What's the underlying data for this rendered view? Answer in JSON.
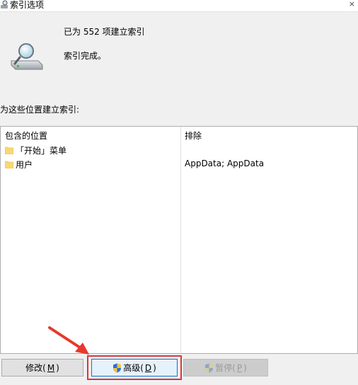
{
  "window": {
    "title": "索引选项",
    "close_icon": "×"
  },
  "status": {
    "count_text": "已为 552 项建立索引",
    "state_text": "索引完成。"
  },
  "locations": {
    "section_label": "为这些位置建立索引:",
    "columns": {
      "included": "包含的位置",
      "excluded": "排除"
    },
    "rows": [
      {
        "location": "「开始」菜单",
        "exclude": ""
      },
      {
        "location": "用户",
        "exclude": "AppData; AppData"
      }
    ]
  },
  "buttons": {
    "modify": {
      "label": "修改(",
      "key": "M",
      "suffix": ")"
    },
    "advanced": {
      "label": "高级(",
      "key": "D",
      "suffix": ")"
    },
    "pause": {
      "label": "暂停(",
      "key": "P",
      "suffix": ")"
    }
  },
  "colors": {
    "highlight_border": "#d9363e",
    "arrow": "#e8382d",
    "folder": "#f8d775",
    "focus_blue": "#0078d7"
  }
}
